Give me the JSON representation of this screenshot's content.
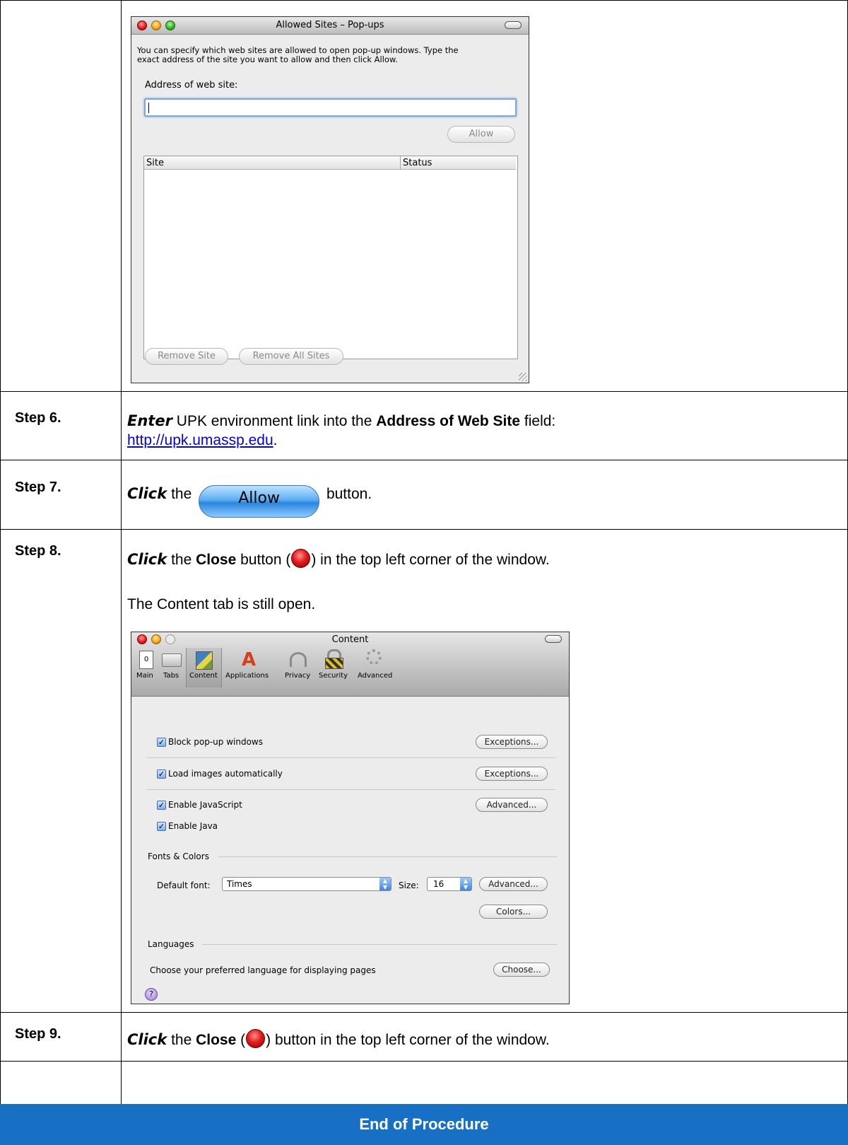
{
  "popups_window": {
    "title": "Allowed Sites – Pop-ups",
    "description_line1": "You can specify which web sites are allowed to open pop-up windows. Type the",
    "description_line2": "exact address of the site you want to allow and then click Allow.",
    "address_label": "Address of web site:",
    "address_value": "",
    "allow_button": "Allow",
    "columns": [
      "Site",
      "Status"
    ],
    "remove_site_button": "Remove Site",
    "remove_all_button": "Remove All Sites"
  },
  "steps": [
    {
      "label": "Step 6.",
      "action": "Enter",
      "t1": " UPK environment link into the ",
      "field": "Address of Web Site",
      "t2": " field:",
      "link": "http://upk.umassp.edu",
      "t3": "."
    },
    {
      "label": "Step 7.",
      "action": "Click",
      "t1": " the ",
      "button_image_label": "Allow",
      "t2": " button."
    },
    {
      "label": "Step 8.",
      "action": "Click",
      "t1": " the ",
      "target": "Close",
      "t2": " button (",
      "t3": ") in the top left corner of the window.",
      "note": "The Content tab is still open."
    },
    {
      "label": "Step 9.",
      "action": "Click",
      "t1": " the ",
      "target": "Close",
      "t2": " (",
      "t3": ") button in the top left corner of the window."
    }
  ],
  "content_window": {
    "title": "Content",
    "toolbar": [
      "Main",
      "Tabs",
      "Content",
      "Applications",
      "Privacy",
      "Security",
      "Advanced"
    ],
    "block_popups": "Block pop-up windows",
    "load_images": "Load images automatically",
    "enable_js": "Enable JavaScript",
    "enable_java": "Enable Java",
    "exceptions_button": "Exceptions...",
    "advanced_button": "Advanced...",
    "fonts_colors_heading": "Fonts & Colors",
    "default_font_label": "Default font:",
    "default_font_value": "Times",
    "size_label": "Size:",
    "size_value": "16",
    "colors_button": "Colors...",
    "languages_heading": "Languages",
    "languages_text": "Choose your preferred language for displaying pages",
    "choose_button": "Choose...",
    "help_glyph": "?"
  },
  "footer": "End of Procedure"
}
